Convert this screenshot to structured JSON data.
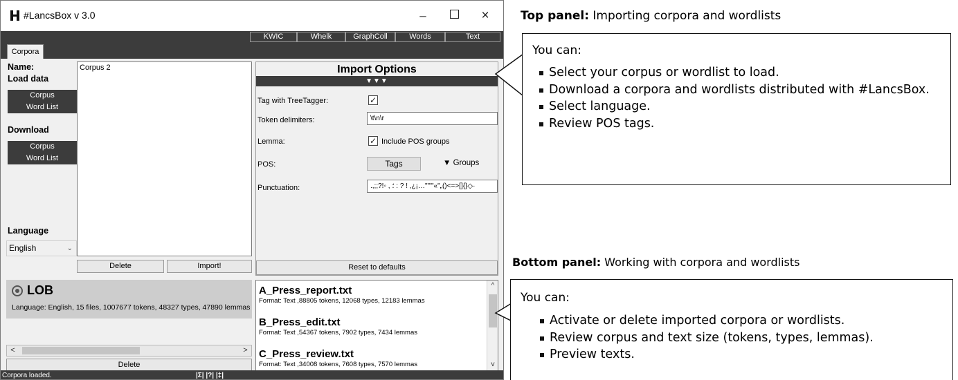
{
  "window": {
    "title": "#LancsBox v 3.0",
    "minimize": "–",
    "close": "×"
  },
  "nav_tabs": [
    "KWIC",
    "Whelk",
    "GraphColl",
    "Words",
    "Text"
  ],
  "corpora_tab": "Corpora",
  "left_panel": {
    "name_label": "Name:",
    "name_value": "Corpus 2",
    "load_data_label": "Load data",
    "load_corpus": "Corpus",
    "load_word_list": "Word List",
    "download_label": "Download",
    "download_corpus": "Corpus",
    "download_word_list": "Word List",
    "language_label": "Language",
    "language_value": "English",
    "delete_button": "Delete",
    "import_button": "Import!"
  },
  "import_options": {
    "title": "Import Options",
    "toggle": "▼▼▼",
    "tag_label": "Tag with TreeTagger:",
    "token_delimiters_label": "Token delimiters:",
    "token_delimiters_value": "\\t\\n\\r",
    "lemma_label": "Lemma:",
    "include_pos_groups": "Include POS groups",
    "pos_label": "POS:",
    "tags_button": "Tags",
    "groups_toggle": "▼ Groups",
    "punctuation_label": "Punctuation:",
    "punctuation_value": ".,;;?!◦ , ؛ : ? ! ,¿¡…\"\"'\"«\"„()<=>[]{}◇·",
    "reset_button": "Reset to defaults"
  },
  "corpus_card": {
    "name": "LOB",
    "info": "Language: English, 15 files, 1007677 tokens, 48327 types, 47890 lemmas",
    "delete_button": "Delete",
    "scroll_left": "<",
    "scroll_right": ">"
  },
  "texts": [
    {
      "name": "A_Press_report.txt",
      "info": "Format: Text ,88805 tokens, 12068 types, 12183 lemmas"
    },
    {
      "name": "B_Press_edit.txt",
      "info": "Format: Text ,54367 tokens, 7902 types, 7434 lemmas"
    },
    {
      "name": "C_Press_review.txt",
      "info": "Format: Text ,34008 tokens, 7608 types, 7570 lemmas"
    }
  ],
  "texts_scroll": {
    "up": "^",
    "down": "v"
  },
  "status": {
    "text": "Corpora loaded.",
    "icons": "|Σ| |?| |‡|"
  },
  "annotation_top": {
    "heading_bold": "Top panel:",
    "heading_rest": " Importing corpora and wordlists",
    "callout_title": "You can:",
    "bullets": [
      "Select your corpus or wordlist to load.",
      "Download a corpora and wordlists distributed with #LancsBox.",
      "Select language.",
      "Review POS tags."
    ]
  },
  "annotation_bottom": {
    "heading_bold": "Bottom panel:",
    "heading_rest": " Working with corpora and wordlists",
    "callout_title": "You can:",
    "bullets": [
      "Activate or delete imported corpora or wordlists.",
      "Review corpus and text size (tokens, types, lemmas).",
      "Preview texts."
    ]
  }
}
